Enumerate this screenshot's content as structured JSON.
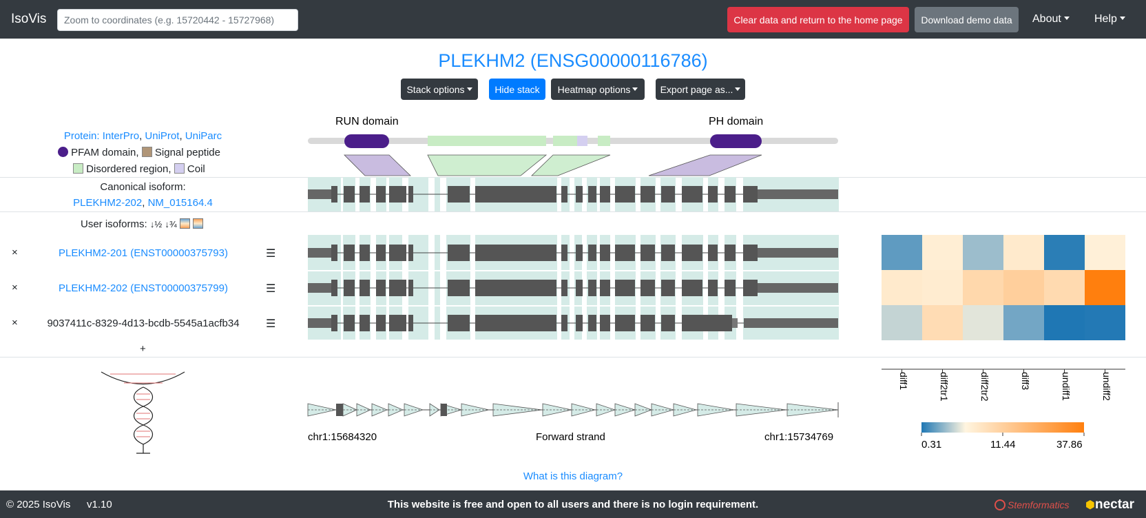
{
  "navbar": {
    "brand": "IsoVis",
    "search_placeholder": "Zoom to coordinates (e.g. 15720442 - 15727968)",
    "clear_button": "Clear data and return to the home page",
    "demo_button": "Download demo data",
    "about": "About",
    "help": "Help"
  },
  "title": "PLEKHM2 (ENSG00000116786)",
  "toolbar": {
    "stack_options": "Stack options",
    "hide_stack": "Hide stack",
    "heatmap_options": "Heatmap options",
    "export": "Export page as..."
  },
  "protein": {
    "label": "Protein",
    "sep": ": ",
    "links": [
      "InterPro",
      "UniProt",
      "UniParc"
    ],
    "legend": {
      "pfam": "PFAM domain,",
      "signal": "Signal peptide",
      "disordered": "Disordered region,",
      "coil": "Coil"
    },
    "domains": [
      "RUN domain",
      "PH domain"
    ]
  },
  "canonical": {
    "label": "Canonical isoform:",
    "links": [
      "PLEKHM2-202",
      "NM_015164.4"
    ]
  },
  "user_isoforms": {
    "label": "User isoforms:",
    "sort_asc": "↓½",
    "sort_desc": "↓¾",
    "add": "+",
    "items": [
      {
        "name": "PLEKHM2-201 (ENST00000375793)",
        "link": true
      },
      {
        "name": "PLEKHM2-202 (ENST00000375799)",
        "link": true
      },
      {
        "name": "9037411c-8329-4d13-bcdb-5545a1acfb34",
        "link": false
      }
    ],
    "remove_glyph": "×",
    "menu_glyph": "☰"
  },
  "coordinates": {
    "start": "chr1:15684320",
    "strand": "Forward strand",
    "end": "chr1:15734769"
  },
  "heatmap": {
    "samples": [
      "diff1",
      "diff2tr1",
      "diff2tr2",
      "diff3",
      "undiff1",
      "undiff2"
    ],
    "values": [
      [
        3.5,
        13.0,
        6.5,
        14.0,
        0.9,
        12.5
      ],
      [
        14.0,
        13.5,
        18.0,
        20.0,
        17.5,
        37.86
      ],
      [
        8.5,
        17.0,
        10.0,
        4.5,
        0.31,
        0.5
      ]
    ],
    "scale": {
      "min": "0.31",
      "mid": "11.44",
      "max": "37.86"
    },
    "colors": {
      "low": "#1f77b4",
      "mid": "#fff5e0",
      "high": "#ff7f0e"
    }
  },
  "what_link": "What is this diagram?",
  "footer": {
    "copyright": "© 2025 IsoVis",
    "version": "v1.10",
    "message": "This website is free and open to all users and there is no login requirement.",
    "partner1": "Stemformatics",
    "partner2": "nectar"
  }
}
